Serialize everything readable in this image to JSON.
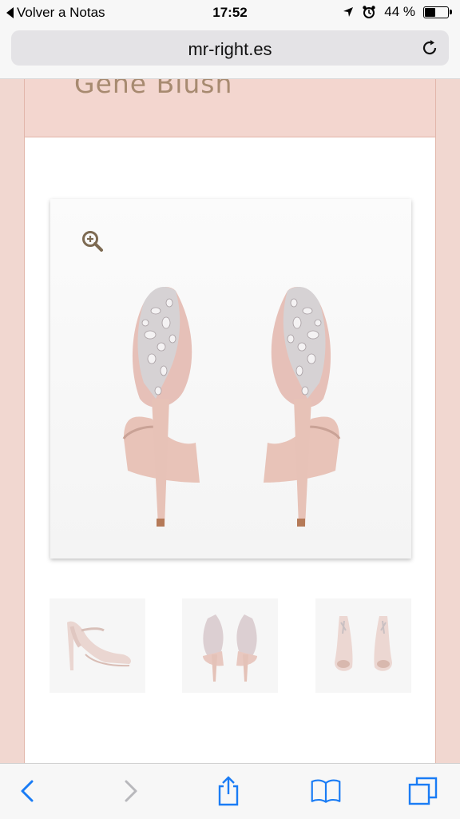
{
  "status_bar": {
    "back_app": "Volver a Notas",
    "time": "17:52",
    "battery_percent": "44 %",
    "battery_level": 0.44
  },
  "address_bar": {
    "url": "mr-right.es"
  },
  "product": {
    "title": "Gene Blush"
  },
  "colors": {
    "page_background": "#f1d7d0",
    "title_color": "#a78a70",
    "accent_ios_blue": "#1a7cf5"
  },
  "icons": {
    "zoom": "zoom-in-icon",
    "reload": "reload-icon",
    "back": "chevron-left-icon",
    "forward": "chevron-right-icon",
    "share": "share-icon",
    "bookmarks": "book-icon",
    "tabs": "tabs-icon"
  }
}
